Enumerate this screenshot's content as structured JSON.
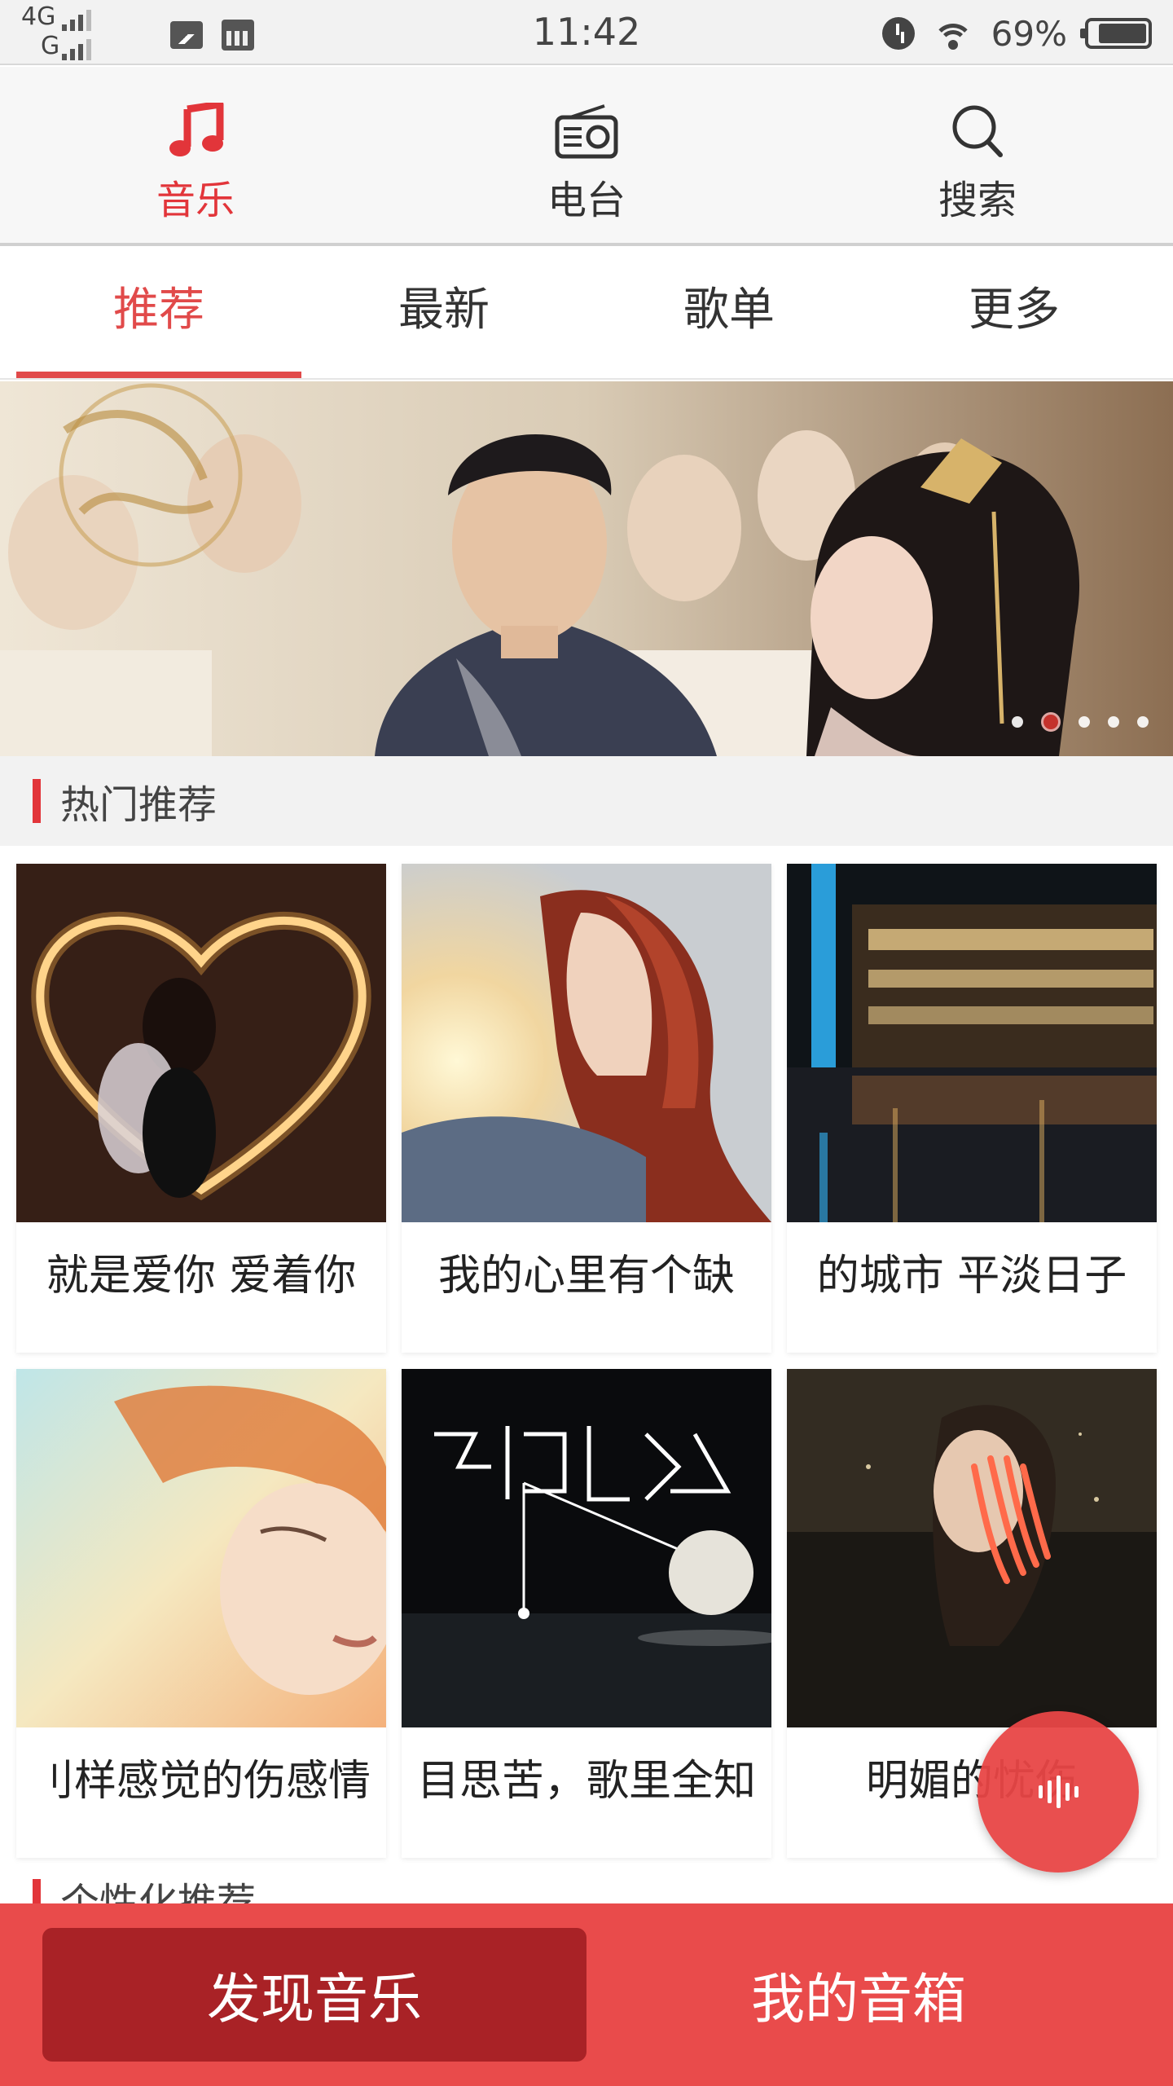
{
  "status_bar": {
    "network_top": "4G",
    "network_bottom": "G",
    "time": "11:42",
    "battery": "69%"
  },
  "top_nav": {
    "items": [
      {
        "label": "音乐",
        "icon": "music-note-icon",
        "active": true
      },
      {
        "label": "电台",
        "icon": "radio-icon",
        "active": false
      },
      {
        "label": "搜索",
        "icon": "search-icon",
        "active": false
      }
    ]
  },
  "tabs": [
    {
      "label": "推荐",
      "active": true
    },
    {
      "label": "最新",
      "active": false
    },
    {
      "label": "歌单",
      "active": false
    },
    {
      "label": "更多",
      "active": false
    }
  ],
  "banner": {
    "slides_total": 5,
    "active_slide": 2
  },
  "hot_section": {
    "title": "热门推荐",
    "playlists": [
      {
        "title": "就是爱你 爱着你"
      },
      {
        "title": "我的心里有个缺"
      },
      {
        "title": "的城市 平淡日子"
      },
      {
        "title": "刂样感觉的伤感情"
      },
      {
        "title": "目思苦，歌里全知"
      },
      {
        "title": "明媚的忧伤"
      }
    ]
  },
  "next_section": {
    "title": "个性化推荐"
  },
  "bottom_bar": {
    "discover_label": "发现音乐",
    "mybox_label": "我的音箱"
  },
  "colors": {
    "accent": "#e2353a",
    "bottom_bar": "#e94b4b",
    "discover_button": "#a92226"
  }
}
